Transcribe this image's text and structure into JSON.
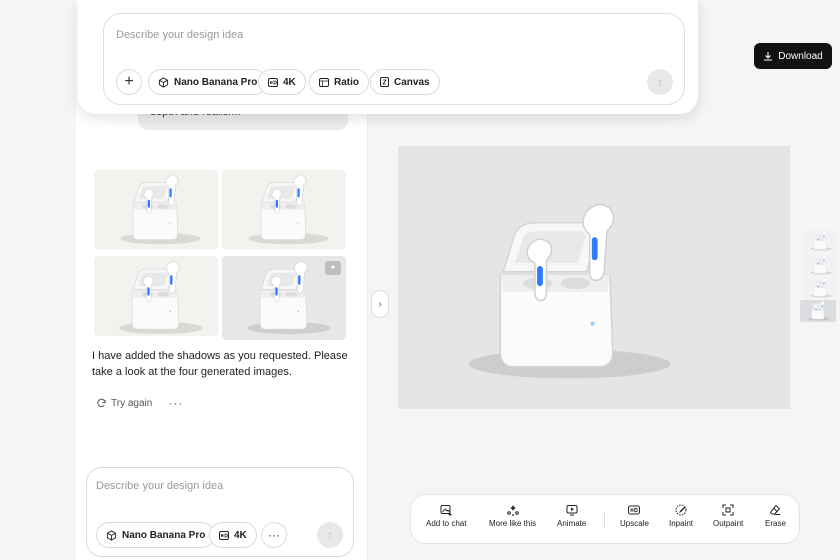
{
  "top_composer": {
    "placeholder": "Describe your design idea",
    "model_label": "Nano Banana Pro",
    "resolution_label": "4K",
    "ratio_label": "Ratio",
    "canvas_label": "Canvas"
  },
  "download_label": "Download",
  "chat": {
    "previous_message_tail": "depth and realism.",
    "reply_text": "I have added the shadows as you requested. Please take a look at the four generated images.",
    "try_again_label": "Try again",
    "more_label": "···"
  },
  "bottom_composer": {
    "placeholder": "Describe your design idea",
    "model_label": "Nano Banana Pro",
    "resolution_label": "4K",
    "more_label": "···"
  },
  "toolbar": {
    "add_to_chat": "Add to chat",
    "more_like_this": "More like this",
    "animate": "Animate",
    "upscale": "Upscale",
    "inpaint": "Inpaint",
    "outpaint": "Outpaint",
    "erase": "Erase"
  },
  "colors": {
    "download_bg": "#111111",
    "panel_bg": "#ffffff",
    "canvas_bg": "#f5f5f5"
  }
}
